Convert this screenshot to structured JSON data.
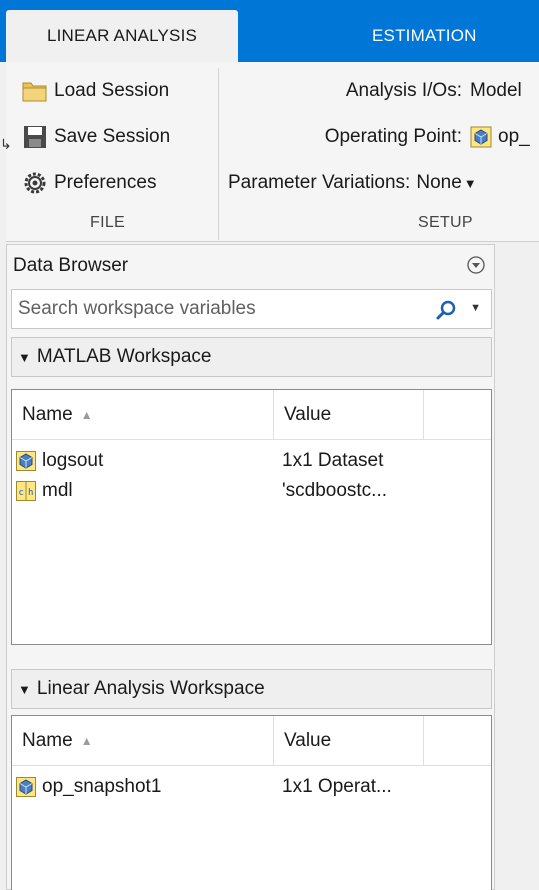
{
  "tabs": {
    "active": "LINEAR ANALYSIS",
    "inactive": "ESTIMATION"
  },
  "file_section": {
    "load_session": "Load Session",
    "save_session": "Save Session",
    "preferences": "Preferences",
    "label": "FILE"
  },
  "setup_section": {
    "analysis_ios_label": "Analysis I/Os:",
    "analysis_ios_value": "Model",
    "operating_point_label": "Operating Point:",
    "operating_point_value": "op_",
    "parameter_variations_label": "Parameter Variations:",
    "parameter_variations_value": "None",
    "label": "SETUP"
  },
  "data_browser": {
    "title": "Data Browser",
    "search_placeholder": "Search workspace variables"
  },
  "matlab_workspace": {
    "title": "MATLAB Workspace",
    "col_name": "Name",
    "col_value": "Value",
    "rows": [
      {
        "name": "logsout",
        "value": "1x1 Dataset",
        "icon": "dataset-icon"
      },
      {
        "name": "mdl",
        "value": "'scdboostc...",
        "icon": "char-icon"
      }
    ]
  },
  "linear_workspace": {
    "title": "Linear Analysis Workspace",
    "col_name": "Name",
    "col_value": "Value",
    "rows": [
      {
        "name": "op_snapshot1",
        "value": "1x1 Operat...",
        "icon": "operating-point-icon"
      }
    ]
  },
  "colors": {
    "tab_blue": "#0076d6",
    "background": "#f0f0f0"
  }
}
